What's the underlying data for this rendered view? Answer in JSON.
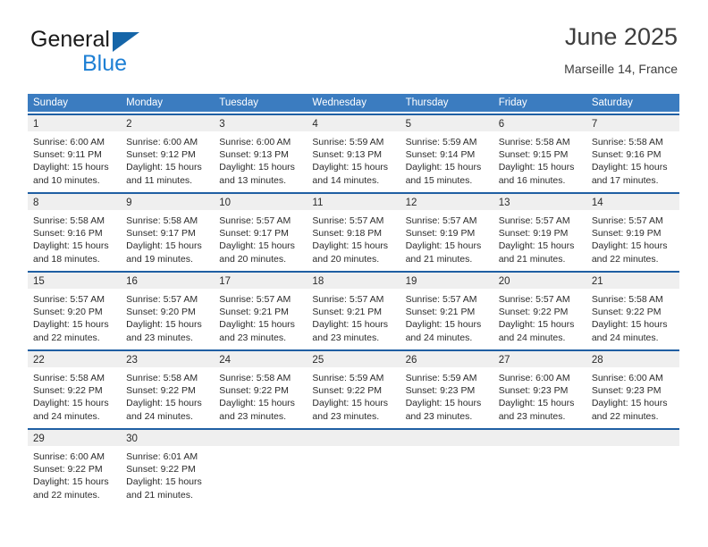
{
  "brand": {
    "name_part1": "General",
    "name_part2": "Blue",
    "triangle_icon": "triangle-logo-icon",
    "colors": {
      "general": "#1a1a1a",
      "blue": "#1d7fd4",
      "triangle": "#1565a8"
    }
  },
  "header": {
    "title": "June 2025",
    "location": "Marseille 14, France"
  },
  "theme": {
    "header_row_bg": "#3b7cc0",
    "week_rule": "#1f5fa3",
    "daynum_band_bg": "#efefef",
    "text": "#2b2b2b"
  },
  "weekdays": [
    "Sunday",
    "Monday",
    "Tuesday",
    "Wednesday",
    "Thursday",
    "Friday",
    "Saturday"
  ],
  "weeks": [
    [
      {
        "day": "1",
        "lines": [
          "Sunrise: 6:00 AM",
          "Sunset: 9:11 PM",
          "Daylight: 15 hours",
          "and 10 minutes."
        ]
      },
      {
        "day": "2",
        "lines": [
          "Sunrise: 6:00 AM",
          "Sunset: 9:12 PM",
          "Daylight: 15 hours",
          "and 11 minutes."
        ]
      },
      {
        "day": "3",
        "lines": [
          "Sunrise: 6:00 AM",
          "Sunset: 9:13 PM",
          "Daylight: 15 hours",
          "and 13 minutes."
        ]
      },
      {
        "day": "4",
        "lines": [
          "Sunrise: 5:59 AM",
          "Sunset: 9:13 PM",
          "Daylight: 15 hours",
          "and 14 minutes."
        ]
      },
      {
        "day": "5",
        "lines": [
          "Sunrise: 5:59 AM",
          "Sunset: 9:14 PM",
          "Daylight: 15 hours",
          "and 15 minutes."
        ]
      },
      {
        "day": "6",
        "lines": [
          "Sunrise: 5:58 AM",
          "Sunset: 9:15 PM",
          "Daylight: 15 hours",
          "and 16 minutes."
        ]
      },
      {
        "day": "7",
        "lines": [
          "Sunrise: 5:58 AM",
          "Sunset: 9:16 PM",
          "Daylight: 15 hours",
          "and 17 minutes."
        ]
      }
    ],
    [
      {
        "day": "8",
        "lines": [
          "Sunrise: 5:58 AM",
          "Sunset: 9:16 PM",
          "Daylight: 15 hours",
          "and 18 minutes."
        ]
      },
      {
        "day": "9",
        "lines": [
          "Sunrise: 5:58 AM",
          "Sunset: 9:17 PM",
          "Daylight: 15 hours",
          "and 19 minutes."
        ]
      },
      {
        "day": "10",
        "lines": [
          "Sunrise: 5:57 AM",
          "Sunset: 9:17 PM",
          "Daylight: 15 hours",
          "and 20 minutes."
        ]
      },
      {
        "day": "11",
        "lines": [
          "Sunrise: 5:57 AM",
          "Sunset: 9:18 PM",
          "Daylight: 15 hours",
          "and 20 minutes."
        ]
      },
      {
        "day": "12",
        "lines": [
          "Sunrise: 5:57 AM",
          "Sunset: 9:19 PM",
          "Daylight: 15 hours",
          "and 21 minutes."
        ]
      },
      {
        "day": "13",
        "lines": [
          "Sunrise: 5:57 AM",
          "Sunset: 9:19 PM",
          "Daylight: 15 hours",
          "and 21 minutes."
        ]
      },
      {
        "day": "14",
        "lines": [
          "Sunrise: 5:57 AM",
          "Sunset: 9:19 PM",
          "Daylight: 15 hours",
          "and 22 minutes."
        ]
      }
    ],
    [
      {
        "day": "15",
        "lines": [
          "Sunrise: 5:57 AM",
          "Sunset: 9:20 PM",
          "Daylight: 15 hours",
          "and 22 minutes."
        ]
      },
      {
        "day": "16",
        "lines": [
          "Sunrise: 5:57 AM",
          "Sunset: 9:20 PM",
          "Daylight: 15 hours",
          "and 23 minutes."
        ]
      },
      {
        "day": "17",
        "lines": [
          "Sunrise: 5:57 AM",
          "Sunset: 9:21 PM",
          "Daylight: 15 hours",
          "and 23 minutes."
        ]
      },
      {
        "day": "18",
        "lines": [
          "Sunrise: 5:57 AM",
          "Sunset: 9:21 PM",
          "Daylight: 15 hours",
          "and 23 minutes."
        ]
      },
      {
        "day": "19",
        "lines": [
          "Sunrise: 5:57 AM",
          "Sunset: 9:21 PM",
          "Daylight: 15 hours",
          "and 24 minutes."
        ]
      },
      {
        "day": "20",
        "lines": [
          "Sunrise: 5:57 AM",
          "Sunset: 9:22 PM",
          "Daylight: 15 hours",
          "and 24 minutes."
        ]
      },
      {
        "day": "21",
        "lines": [
          "Sunrise: 5:58 AM",
          "Sunset: 9:22 PM",
          "Daylight: 15 hours",
          "and 24 minutes."
        ]
      }
    ],
    [
      {
        "day": "22",
        "lines": [
          "Sunrise: 5:58 AM",
          "Sunset: 9:22 PM",
          "Daylight: 15 hours",
          "and 24 minutes."
        ]
      },
      {
        "day": "23",
        "lines": [
          "Sunrise: 5:58 AM",
          "Sunset: 9:22 PM",
          "Daylight: 15 hours",
          "and 24 minutes."
        ]
      },
      {
        "day": "24",
        "lines": [
          "Sunrise: 5:58 AM",
          "Sunset: 9:22 PM",
          "Daylight: 15 hours",
          "and 23 minutes."
        ]
      },
      {
        "day": "25",
        "lines": [
          "Sunrise: 5:59 AM",
          "Sunset: 9:22 PM",
          "Daylight: 15 hours",
          "and 23 minutes."
        ]
      },
      {
        "day": "26",
        "lines": [
          "Sunrise: 5:59 AM",
          "Sunset: 9:23 PM",
          "Daylight: 15 hours",
          "and 23 minutes."
        ]
      },
      {
        "day": "27",
        "lines": [
          "Sunrise: 6:00 AM",
          "Sunset: 9:23 PM",
          "Daylight: 15 hours",
          "and 23 minutes."
        ]
      },
      {
        "day": "28",
        "lines": [
          "Sunrise: 6:00 AM",
          "Sunset: 9:23 PM",
          "Daylight: 15 hours",
          "and 22 minutes."
        ]
      }
    ],
    [
      {
        "day": "29",
        "lines": [
          "Sunrise: 6:00 AM",
          "Sunset: 9:22 PM",
          "Daylight: 15 hours",
          "and 22 minutes."
        ]
      },
      {
        "day": "30",
        "lines": [
          "Sunrise: 6:01 AM",
          "Sunset: 9:22 PM",
          "Daylight: 15 hours",
          "and 21 minutes."
        ]
      },
      {
        "day": "",
        "lines": []
      },
      {
        "day": "",
        "lines": []
      },
      {
        "day": "",
        "lines": []
      },
      {
        "day": "",
        "lines": []
      },
      {
        "day": "",
        "lines": []
      }
    ]
  ]
}
